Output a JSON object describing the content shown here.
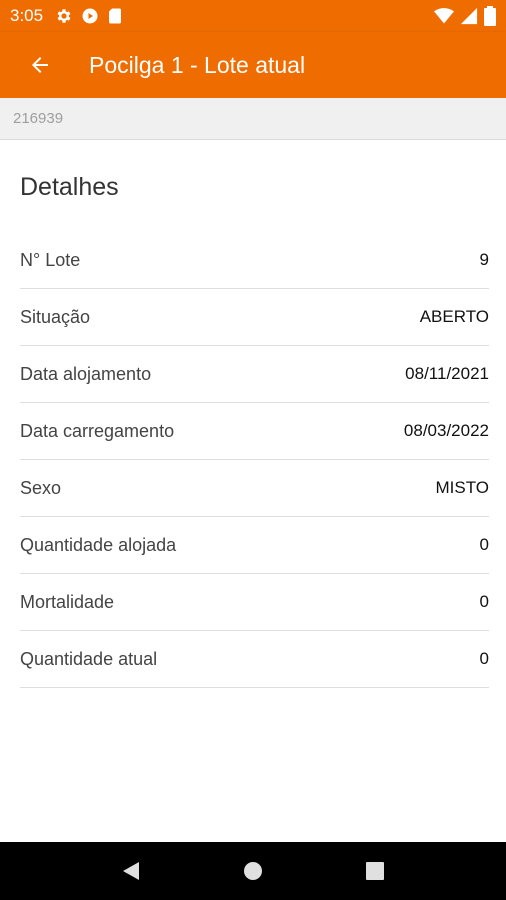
{
  "status_bar": {
    "time": "3:05",
    "left_icons": [
      "gear-icon",
      "play-protect-icon",
      "sd-card-icon"
    ],
    "right_icons": [
      "wifi-icon",
      "signal-icon",
      "battery-icon"
    ]
  },
  "app_bar": {
    "title": "Pocilga 1 - Lote atual",
    "back_icon": "arrow-left-icon",
    "background": "#ef6c00"
  },
  "sub_bar": {
    "code": "216939"
  },
  "details": {
    "title": "Detalhes",
    "rows": [
      {
        "label": "N° Lote",
        "value": "9"
      },
      {
        "label": "Situação",
        "value": "ABERTO"
      },
      {
        "label": "Data alojamento",
        "value": "08/11/2021"
      },
      {
        "label": "Data carregamento",
        "value": "08/03/2022"
      },
      {
        "label": "Sexo",
        "value": "MISTO"
      },
      {
        "label": "Quantidade alojada",
        "value": "0"
      },
      {
        "label": "Mortalidade",
        "value": "0"
      },
      {
        "label": "Quantidade atual",
        "value": "0"
      }
    ]
  },
  "nav_bar": {
    "buttons": [
      "back-triangle-icon",
      "home-circle-icon",
      "recents-square-icon"
    ]
  }
}
